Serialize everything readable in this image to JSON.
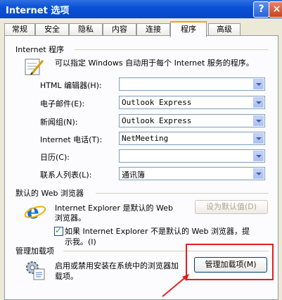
{
  "window": {
    "title": "Internet 选项",
    "help": "?",
    "close": "×"
  },
  "tabs": [
    "常规",
    "安全",
    "隐私",
    "内容",
    "连接",
    "程序",
    "高级"
  ],
  "programs": {
    "group_title": "Internet 程序",
    "description": "可以指定 Windows 自动用于每个 Internet 服务的程序。",
    "rows": [
      {
        "label": "HTML 编辑器(H):",
        "value": ""
      },
      {
        "label": "电子邮件(E):",
        "value": "Outlook Express"
      },
      {
        "label": "新闻组(N):",
        "value": "Outlook Express"
      },
      {
        "label": "Internet 电话(T):",
        "value": "NetMeeting"
      },
      {
        "label": "日历(C):",
        "value": ""
      },
      {
        "label": "联系人列表(L):",
        "value": "通讯簿"
      }
    ]
  },
  "browser": {
    "group_title": "默认的 Web 浏览器",
    "line1": "Internet Explorer 是默认的 Web",
    "line2": "浏览器。",
    "set_default": "设为默认值(D)",
    "check_line1": "如果 Internet Explorer 不是默认的 Web 浏览器，提",
    "check_line2": "示我。(I)"
  },
  "addons": {
    "group_title": "管理加载项",
    "line1": "启用或禁用安装在系统中的浏览器加",
    "line2": "载项。",
    "button": "管理加载项(M)"
  },
  "colors": {
    "accent": "#0a52d8",
    "highlight": "#e02020"
  }
}
